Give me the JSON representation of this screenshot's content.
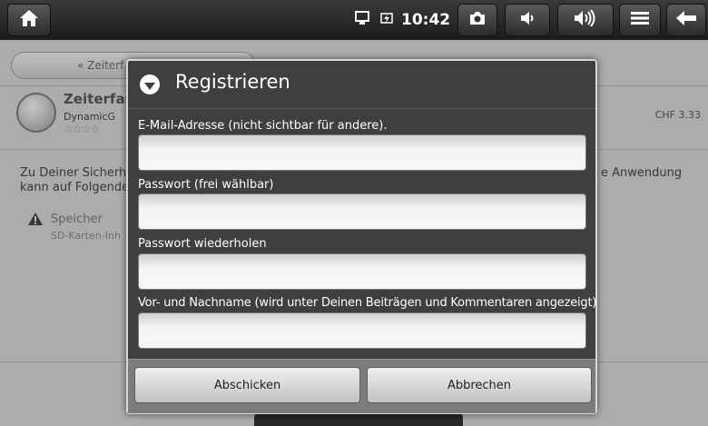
{
  "statusbar": {
    "time": "10:42",
    "icons": [
      "home-icon",
      "usb-icon",
      "charging-icon",
      "camera-icon",
      "volume-down-icon",
      "volume-up-icon",
      "menu-icon",
      "back-arrow-icon"
    ]
  },
  "background_app": {
    "back_label": "« Zeiterf",
    "app_name": "Zeiterfas",
    "developer": "DynamicG",
    "rating_stars": "☆☆☆☆",
    "price": "CHF 3.33",
    "text_line1": "Zu Deiner Sicherh",
    "text_line2": "kann auf Folgende",
    "text_right": "e Anwendung",
    "permission_title": "Speicher",
    "permission_desc": "SD-Karten-Inh"
  },
  "dialog": {
    "title": "Registrieren",
    "fields": [
      {
        "label": "E-Mail-Adresse (nicht sichtbar für andere).",
        "value": ""
      },
      {
        "label": "Passwort (frei wählbar)",
        "value": ""
      },
      {
        "label": "Passwort wiederholen",
        "value": ""
      },
      {
        "label": "Vor- und Nachname (wird unter Deinen Beiträgen und Kommentaren angezeigt)",
        "value": ""
      }
    ],
    "submit_label": "Abschicken",
    "cancel_label": "Abbrechen"
  }
}
